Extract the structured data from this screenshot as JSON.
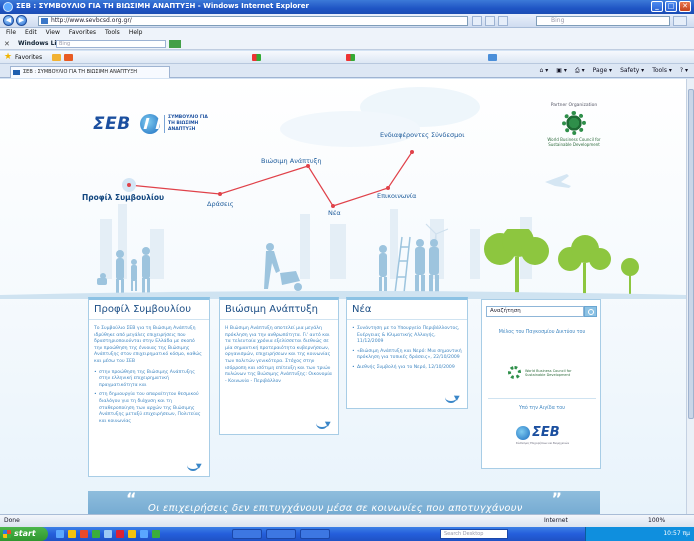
{
  "window": {
    "title": "ΣΕΒ : ΣΥΜΒΟΥΛΙΟ ΓΙΑ ΤΗ ΒΙΩΣΙΜΗ ΑΝΑΠΤΥΞΗ - Windows Internet Explorer",
    "address": "http://www.sevbcsd.org.gr/",
    "search_placeholder": "Bing",
    "menu": [
      "File",
      "Edit",
      "View",
      "Favorites",
      "Tools",
      "Help"
    ],
    "links_bar": {
      "close": "✕",
      "label": "Windows Live",
      "search_placeholder": "Bing"
    },
    "favorites_label": "Favorites",
    "tab_title": "ΣΕΒ : ΣΥΜΒΟΥΛΙΟ ΓΙΑ ΤΗ ΒΙΩΣΙΜΗ ΑΝΑΠΤΥΞΗ",
    "command_bar": [
      "Page ▾",
      "Safety ▾",
      "Tools ▾"
    ],
    "buttons": {
      "minimize": "_",
      "maximize": "□",
      "close": "✕",
      "back": "◀",
      "forward": "▶"
    }
  },
  "page": {
    "logo": {
      "text": "ΣΕΒ",
      "subtitle": "ΣΥΜΒΟΥΛΙΟ ΓΙΑ ΤΗ ΒΙΩΣΙΜΗ ΑΝΑΠΤΥΞΗ"
    },
    "partner": {
      "label": "Partner Organization",
      "name": "World Business Council for Sustainable Development"
    },
    "nav": {
      "profile": "Προφίλ Συμβουλίου",
      "actions": "Δράσεις",
      "sustainability": "Βιώσιμη Ανάπτυξη",
      "news": "Νέα",
      "contact": "Επικοινωνία",
      "links": "Ενδιαφέροντες Σύνδεσμοι"
    },
    "boxes": {
      "profile": {
        "title": "Προφίλ Συμβουλίου",
        "text": "Το Συμβούλιο ΣΕΒ για τη Βιώσιμη Ανάπτυξη ιδρύθηκε από μεγάλες επιχειρήσεις που δραστηριοποιούνται στην Ελλάδα με σκοπό την προώθηση της έννοιας της Βιώσιμης Ανάπτυξης στον επιχειρηματικό κόσμο, καθώς και μέσω του ΣΕΒ",
        "bullets": [
          "στην προώθηση της Βιώσιμης Ανάπτυξης στην ελληνική επιχειρηματική πραγματικότητα και",
          "στη δημιουργία του απαραίτητου θεσμικού διαλόγου για τη διάχυση και τη σταθεροποίηση των αρχών της Βιώσιμης Ανάπτυξης μεταξύ επιχειρήσεων, Πολιτείας και κοινωνίας"
        ]
      },
      "sustainability": {
        "title": "Βιώσιμη Ανάπτυξη",
        "text": "Η Βιώσιμη Ανάπτυξη αποτελεί μια μεγάλη πρόκληση για την ανθρωπότητα. Γι' αυτό και τα τελευταία χρόνια εξελίσσεται διεθνώς σε μία σημαντική προτεραιότητα κυβερνήσεων, οργανισμών, επιχειρήσεων και της κοινωνίας των πολιτών γενικότερα. Στόχος στην ισόρροπη και ισότιμη επίτευξη και των τριών πυλώνων της Βιώσιμης Ανάπτυξης: Οικονομία - Κοινωνία - Περιβάλλον"
      },
      "news": {
        "title": "Νέα",
        "items": [
          "Συνάντηση με το Υπουργείο Περιβάλλοντος, Ενέργειας & Κλιματικής Αλλαγής, 11/12/2009",
          "«Βιώσιμη Ανάπτυξη και Νερό: Μια σημαντική πρόκληση για τοπικές δράσεις», 22/10/2009",
          "Διεθνής Συμβολή για το Νερό, 12/10/2009"
        ]
      }
    },
    "sidebar": {
      "search_value": "Αναζήτηση",
      "member_label": "Μέλος του Παγκοσμίου Δικτύου του",
      "wbcsd_name": "World Business Council for Sustainable Development",
      "initiative_label": "Υπό την Αιγίδα του",
      "seb_text": "ΣΕΒ",
      "seb_sub": "Σύνδεσμος Επιχειρήσεων και Βιομηχανιών"
    },
    "quote": {
      "open": "“",
      "close": "”",
      "text": "Οι επιχειρήσεις δεν επιτυγχάνουν μέσα σε κοινωνίες που αποτυγχάνουν"
    }
  },
  "status": {
    "left": "Done",
    "zone": "Internet",
    "zoom": "100%"
  },
  "taskbar": {
    "start": "start",
    "search_placeholder": "Search Desktop",
    "clock": "10:57 πμ"
  },
  "colors": {
    "brand_blue": "#1b4f9f",
    "nav_line": "#e0424a",
    "link_blue": "#3f86c1",
    "accent": "#8cc2e4"
  }
}
